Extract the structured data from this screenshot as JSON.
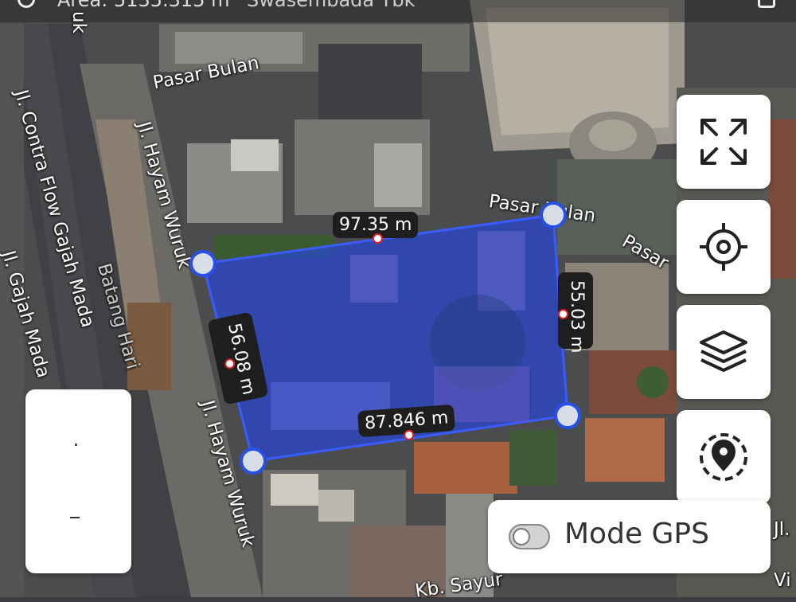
{
  "topbar": {
    "area_text": "Area: 5135.315 m",
    "place_text": "Swasembada Tbk"
  },
  "map": {
    "road_labels": {
      "pasar_bulan_top": "Pasar Bulan",
      "pasar_bulan_mid": "Pasar Bulan",
      "pasar_right": "Pasar",
      "jl_hayam_wuruk_upper": "Jl. Hayam Wuruk",
      "jl_hayam_wuruk_lower": "Jl. Hayam Wuruk",
      "jl_contra_flow": "Jl. Contra Flow Gajah Mada",
      "jl_gajah_mada": "Jl. Gajah Mada",
      "batang_hari": "Batang Hari",
      "kb_sayur": "Kb. Sayur",
      "right_edge_jl": "Jl.",
      "right_edge_vi": "Vi",
      "top_left_fragment": "uk"
    },
    "measurements": {
      "top": "97.35 m",
      "right": "55.03 m",
      "left": "56.08 m",
      "bottom": "87.846 m"
    },
    "polygon_color": "#2244ee"
  },
  "controls": {
    "fullscreen_icon": "expand-icon",
    "locate_icon": "crosshair-icon",
    "layers_icon": "layers-icon",
    "location_pin_icon": "location-pin-icon"
  },
  "gps_mode": {
    "label": "Mode GPS",
    "enabled": false
  }
}
